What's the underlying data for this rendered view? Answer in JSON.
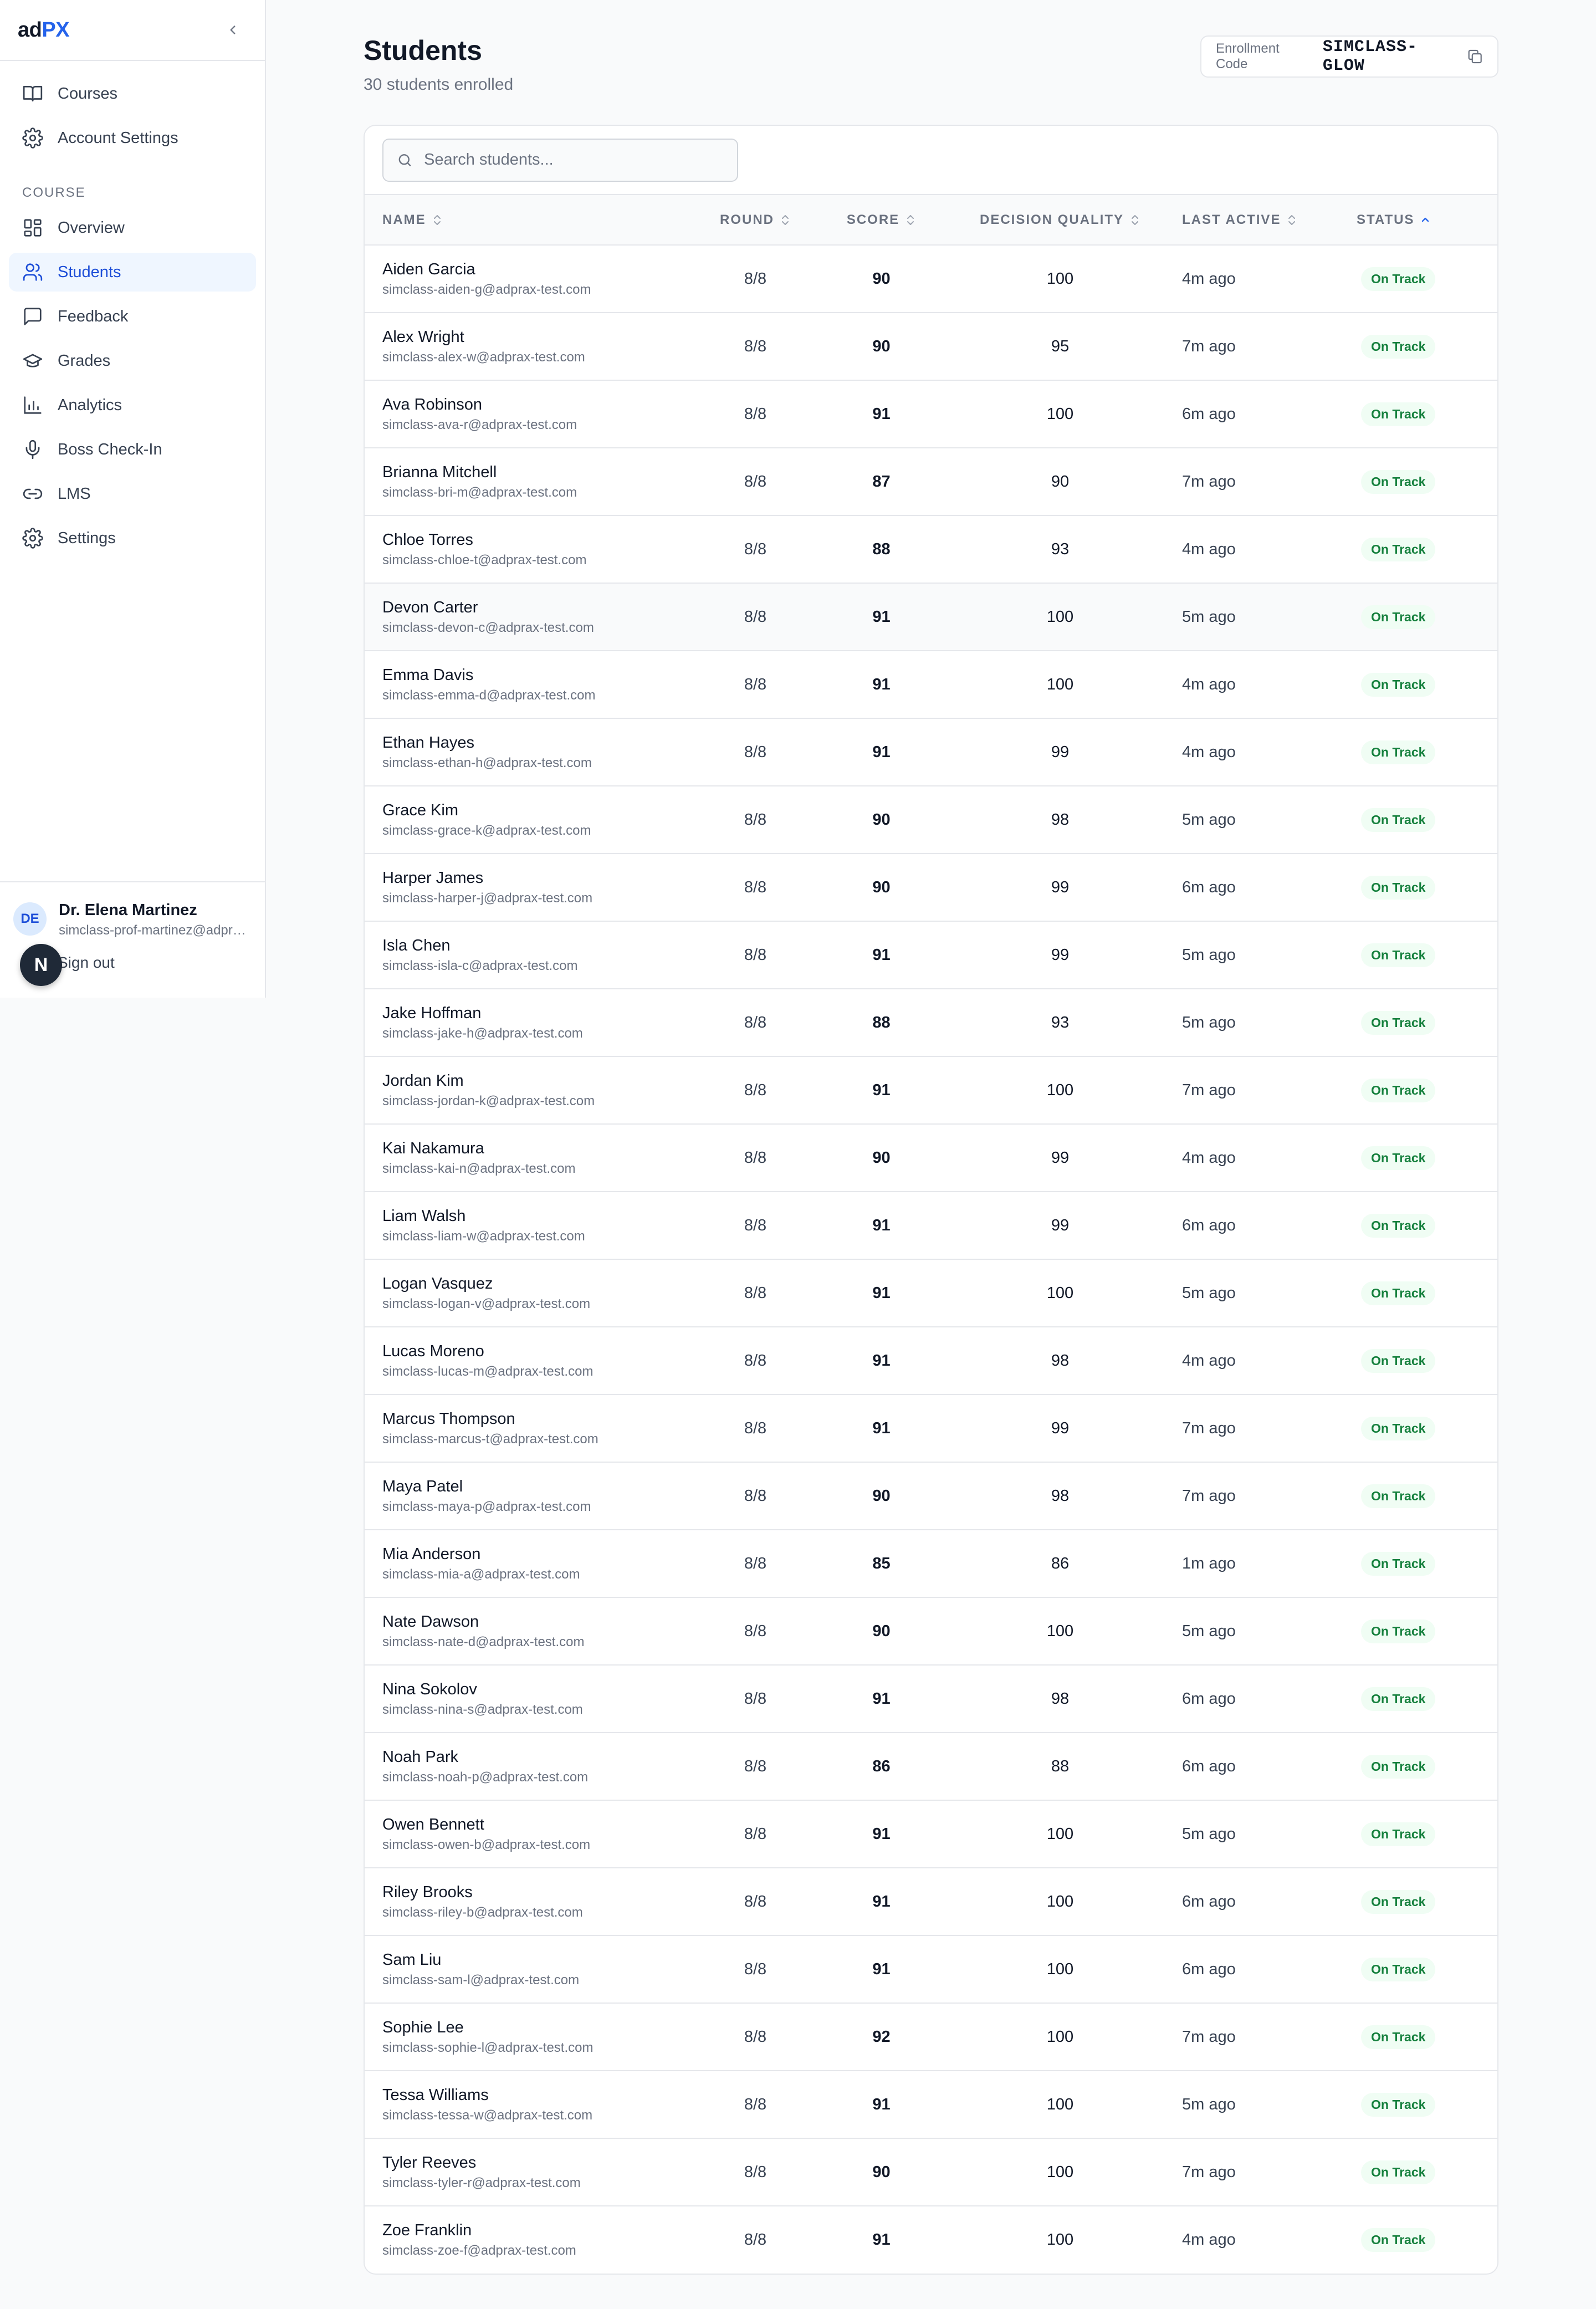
{
  "sidebar": {
    "logo_prefix": "ad",
    "logo_suffix": "PX",
    "top_items": [
      {
        "label": "Courses",
        "icon": "book-icon"
      },
      {
        "label": "Account Settings",
        "icon": "gear-icon"
      }
    ],
    "section_label": "COURSE",
    "course_items": [
      {
        "label": "Overview",
        "icon": "grid-icon"
      },
      {
        "label": "Students",
        "icon": "users-icon",
        "active": true
      },
      {
        "label": "Feedback",
        "icon": "message-icon"
      },
      {
        "label": "Grades",
        "icon": "graduation-cap-icon"
      },
      {
        "label": "Analytics",
        "icon": "bar-chart-icon"
      },
      {
        "label": "Boss Check-In",
        "icon": "microphone-icon"
      },
      {
        "label": "LMS",
        "icon": "link-icon"
      },
      {
        "label": "Settings",
        "icon": "gear-icon"
      }
    ],
    "user": {
      "initials": "DE",
      "name": "Dr. Elena Martinez",
      "email": "simclass-prof-martinez@adprax-test.com"
    },
    "sign_out": "Sign out",
    "floating_badge": "N"
  },
  "header": {
    "title": "Students",
    "subtitle": "30 students enrolled",
    "enrollment_label": "Enrollment Code",
    "enrollment_code": "SIMCLASS-GLOW"
  },
  "search": {
    "placeholder": "Search students..."
  },
  "table": {
    "columns": {
      "name": "NAME",
      "round": "ROUND",
      "score": "SCORE",
      "decision_quality": "DECISION QUALITY",
      "last_active": "LAST ACTIVE",
      "status": "STATUS"
    },
    "sorted_by": "status",
    "sort_direction": "ascending",
    "rows": [
      {
        "name": "Aiden Garcia",
        "email": "simclass-aiden-g@adprax-test.com",
        "round": "8",
        "round_total": "/8",
        "score": "90",
        "dq": "100",
        "last": "4m ago",
        "status": "On Track"
      },
      {
        "name": "Alex Wright",
        "email": "simclass-alex-w@adprax-test.com",
        "round": "8",
        "round_total": "/8",
        "score": "90",
        "dq": "95",
        "last": "7m ago",
        "status": "On Track"
      },
      {
        "name": "Ava Robinson",
        "email": "simclass-ava-r@adprax-test.com",
        "round": "8",
        "round_total": "/8",
        "score": "91",
        "dq": "100",
        "last": "6m ago",
        "status": "On Track"
      },
      {
        "name": "Brianna Mitchell",
        "email": "simclass-bri-m@adprax-test.com",
        "round": "8",
        "round_total": "/8",
        "score": "87",
        "dq": "90",
        "last": "7m ago",
        "status": "On Track"
      },
      {
        "name": "Chloe Torres",
        "email": "simclass-chloe-t@adprax-test.com",
        "round": "8",
        "round_total": "/8",
        "score": "88",
        "dq": "93",
        "last": "4m ago",
        "status": "On Track"
      },
      {
        "name": "Devon Carter",
        "email": "simclass-devon-c@adprax-test.com",
        "round": "8",
        "round_total": "/8",
        "score": "91",
        "dq": "100",
        "last": "5m ago",
        "status": "On Track",
        "hover": true
      },
      {
        "name": "Emma Davis",
        "email": "simclass-emma-d@adprax-test.com",
        "round": "8",
        "round_total": "/8",
        "score": "91",
        "dq": "100",
        "last": "4m ago",
        "status": "On Track"
      },
      {
        "name": "Ethan Hayes",
        "email": "simclass-ethan-h@adprax-test.com",
        "round": "8",
        "round_total": "/8",
        "score": "91",
        "dq": "99",
        "last": "4m ago",
        "status": "On Track"
      },
      {
        "name": "Grace Kim",
        "email": "simclass-grace-k@adprax-test.com",
        "round": "8",
        "round_total": "/8",
        "score": "90",
        "dq": "98",
        "last": "5m ago",
        "status": "On Track"
      },
      {
        "name": "Harper James",
        "email": "simclass-harper-j@adprax-test.com",
        "round": "8",
        "round_total": "/8",
        "score": "90",
        "dq": "99",
        "last": "6m ago",
        "status": "On Track"
      },
      {
        "name": "Isla Chen",
        "email": "simclass-isla-c@adprax-test.com",
        "round": "8",
        "round_total": "/8",
        "score": "91",
        "dq": "99",
        "last": "5m ago",
        "status": "On Track"
      },
      {
        "name": "Jake Hoffman",
        "email": "simclass-jake-h@adprax-test.com",
        "round": "8",
        "round_total": "/8",
        "score": "88",
        "dq": "93",
        "last": "5m ago",
        "status": "On Track"
      },
      {
        "name": "Jordan Kim",
        "email": "simclass-jordan-k@adprax-test.com",
        "round": "8",
        "round_total": "/8",
        "score": "91",
        "dq": "100",
        "last": "7m ago",
        "status": "On Track"
      },
      {
        "name": "Kai Nakamura",
        "email": "simclass-kai-n@adprax-test.com",
        "round": "8",
        "round_total": "/8",
        "score": "90",
        "dq": "99",
        "last": "4m ago",
        "status": "On Track"
      },
      {
        "name": "Liam Walsh",
        "email": "simclass-liam-w@adprax-test.com",
        "round": "8",
        "round_total": "/8",
        "score": "91",
        "dq": "99",
        "last": "6m ago",
        "status": "On Track"
      },
      {
        "name": "Logan Vasquez",
        "email": "simclass-logan-v@adprax-test.com",
        "round": "8",
        "round_total": "/8",
        "score": "91",
        "dq": "100",
        "last": "5m ago",
        "status": "On Track"
      },
      {
        "name": "Lucas Moreno",
        "email": "simclass-lucas-m@adprax-test.com",
        "round": "8",
        "round_total": "/8",
        "score": "91",
        "dq": "98",
        "last": "4m ago",
        "status": "On Track"
      },
      {
        "name": "Marcus Thompson",
        "email": "simclass-marcus-t@adprax-test.com",
        "round": "8",
        "round_total": "/8",
        "score": "91",
        "dq": "99",
        "last": "7m ago",
        "status": "On Track"
      },
      {
        "name": "Maya Patel",
        "email": "simclass-maya-p@adprax-test.com",
        "round": "8",
        "round_total": "/8",
        "score": "90",
        "dq": "98",
        "last": "7m ago",
        "status": "On Track"
      },
      {
        "name": "Mia Anderson",
        "email": "simclass-mia-a@adprax-test.com",
        "round": "8",
        "round_total": "/8",
        "score": "85",
        "dq": "86",
        "last": "1m ago",
        "status": "On Track"
      },
      {
        "name": "Nate Dawson",
        "email": "simclass-nate-d@adprax-test.com",
        "round": "8",
        "round_total": "/8",
        "score": "90",
        "dq": "100",
        "last": "5m ago",
        "status": "On Track"
      },
      {
        "name": "Nina Sokolov",
        "email": "simclass-nina-s@adprax-test.com",
        "round": "8",
        "round_total": "/8",
        "score": "91",
        "dq": "98",
        "last": "6m ago",
        "status": "On Track"
      },
      {
        "name": "Noah Park",
        "email": "simclass-noah-p@adprax-test.com",
        "round": "8",
        "round_total": "/8",
        "score": "86",
        "dq": "88",
        "last": "6m ago",
        "status": "On Track"
      },
      {
        "name": "Owen Bennett",
        "email": "simclass-owen-b@adprax-test.com",
        "round": "8",
        "round_total": "/8",
        "score": "91",
        "dq": "100",
        "last": "5m ago",
        "status": "On Track"
      },
      {
        "name": "Riley Brooks",
        "email": "simclass-riley-b@adprax-test.com",
        "round": "8",
        "round_total": "/8",
        "score": "91",
        "dq": "100",
        "last": "6m ago",
        "status": "On Track"
      },
      {
        "name": "Sam Liu",
        "email": "simclass-sam-l@adprax-test.com",
        "round": "8",
        "round_total": "/8",
        "score": "91",
        "dq": "100",
        "last": "6m ago",
        "status": "On Track"
      },
      {
        "name": "Sophie Lee",
        "email": "simclass-sophie-l@adprax-test.com",
        "round": "8",
        "round_total": "/8",
        "score": "92",
        "dq": "100",
        "last": "7m ago",
        "status": "On Track"
      },
      {
        "name": "Tessa Williams",
        "email": "simclass-tessa-w@adprax-test.com",
        "round": "8",
        "round_total": "/8",
        "score": "91",
        "dq": "100",
        "last": "5m ago",
        "status": "On Track"
      },
      {
        "name": "Tyler Reeves",
        "email": "simclass-tyler-r@adprax-test.com",
        "round": "8",
        "round_total": "/8",
        "score": "90",
        "dq": "100",
        "last": "7m ago",
        "status": "On Track"
      },
      {
        "name": "Zoe Franklin",
        "email": "simclass-zoe-f@adprax-test.com",
        "round": "8",
        "round_total": "/8",
        "score": "91",
        "dq": "100",
        "last": "4m ago",
        "status": "On Track"
      }
    ]
  },
  "colors": {
    "accent": "#2563eb",
    "active_nav_bg": "#eff6ff",
    "status_on_track_bg": "#f0fdf4",
    "status_on_track_text": "#15803d"
  }
}
